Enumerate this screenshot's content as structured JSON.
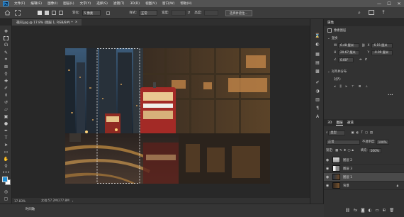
{
  "menubar": {
    "logo": "Ps",
    "items": [
      "文件(F)",
      "编辑(E)",
      "图像(I)",
      "图层(L)",
      "文字(Y)",
      "选择(S)",
      "滤镜(T)",
      "3D(D)",
      "视图(V)",
      "窗口(W)",
      "帮助(H)"
    ]
  },
  "window_controls": {
    "minimize": "—",
    "maximize": "☐",
    "close": "✕"
  },
  "options": {
    "feather_label": "羽化:",
    "feather_value": "5 像素",
    "style_label": "样式:",
    "style_value": "正常",
    "width_label": "宽度:",
    "height_label": "高度:",
    "select_mask": "选择并遮住..."
  },
  "document_tab": "夜间.jpg @ 17.8% (图层 1, RGB/8#) *",
  "tab_close": "×",
  "statusbar": {
    "zoom": "17.83%",
    "doc_info": "文档:57.2M/277.8M"
  },
  "bottombar": {
    "timeline": "时间轴"
  },
  "properties": {
    "tab_label": "属性",
    "layer_type": "像素图层",
    "transform_header": "变换",
    "w_label": "W",
    "w_value": "6.48 厘米",
    "h_label": "H",
    "h_value": "20.67 厘米",
    "x_label": "X",
    "x_value": "6.15 厘米",
    "y_label": "Y",
    "y_value": "-0.09 厘米",
    "angle_value": "0.00°",
    "align_header": "对齐并分布",
    "align_sub": "对齐:"
  },
  "layers_panel": {
    "tabs": [
      "3D",
      "图层",
      "通道"
    ],
    "kind_filter": "类型",
    "blend_mode": "正常",
    "opacity_label": "不透明度:",
    "opacity_value": "100%",
    "lock_label": "锁定:",
    "fill_label": "填充:",
    "fill_value": "100%",
    "layers": [
      {
        "name": "图层 2",
        "selected": false
      },
      {
        "name": "图层 3",
        "selected": false
      },
      {
        "name": "图层 1",
        "selected": true
      },
      {
        "name": "背景",
        "selected": false,
        "locked": true
      }
    ],
    "footer_icons": [
      "link-icon",
      "fx-icon",
      "mask-icon",
      "adjustment-icon",
      "group-icon",
      "new-layer-icon",
      "trash-icon"
    ]
  },
  "colors": {
    "accent": "#31a8ff",
    "foreground": "#1f8fd6",
    "background": "#ffffff"
  }
}
